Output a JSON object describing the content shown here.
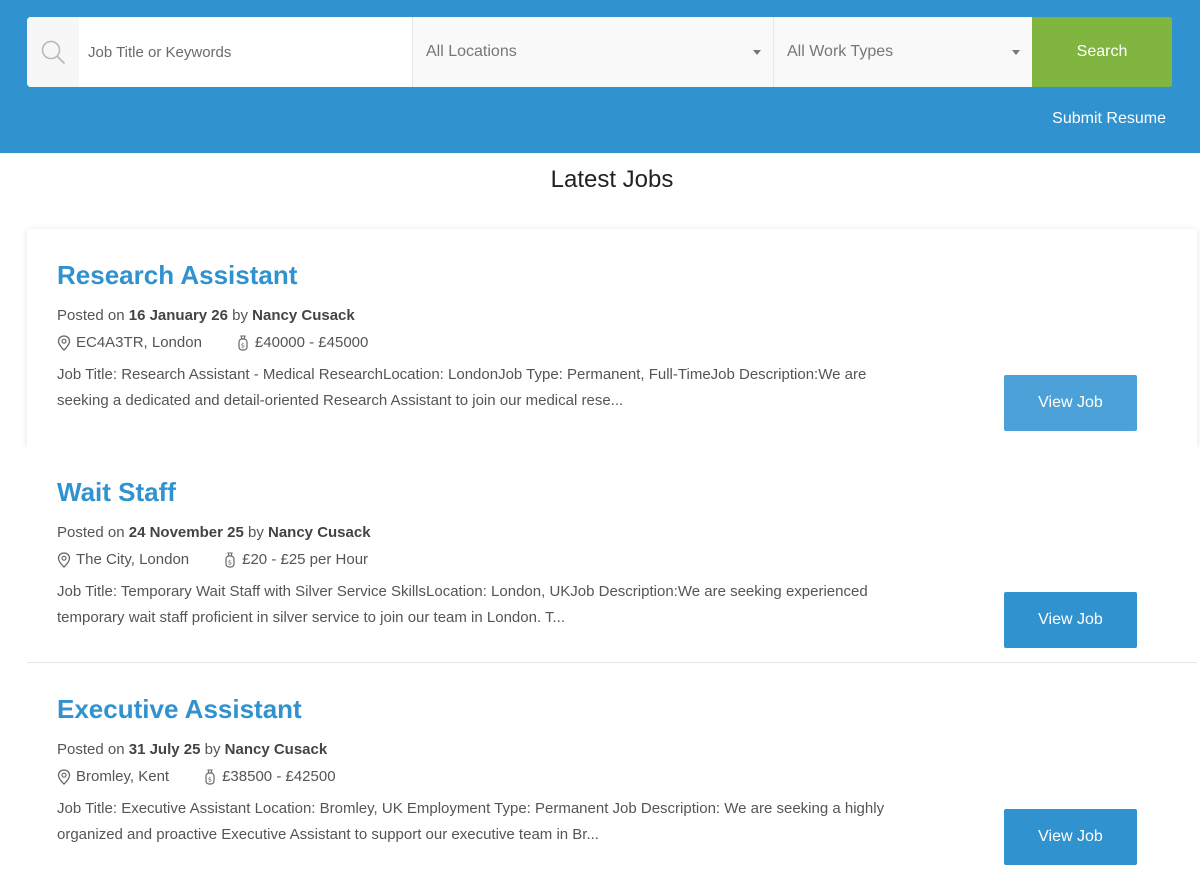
{
  "search": {
    "keywords_placeholder": "Job Title or Keywords",
    "keywords_value": "",
    "location_selected": "All Locations",
    "work_type_selected": "All Work Types",
    "search_label": "Search"
  },
  "header": {
    "submit_resume": "Submit Resume"
  },
  "section": {
    "title": "Latest Jobs"
  },
  "jobs": [
    {
      "title": "Research Assistant",
      "posted_prefix": "Posted on",
      "date": "16 January 26",
      "by_word": "by",
      "author": "Nancy Cusack",
      "location": "EC4A3TR, London",
      "salary": "£40000 - £45000",
      "description": "Job Title: Research Assistant - Medical ResearchLocation: LondonJob Type: Permanent, Full-TimeJob Description:We are seeking a dedicated and detail-oriented Research Assistant to join our medical rese...",
      "button": "View Job"
    },
    {
      "title": "Wait Staff",
      "posted_prefix": "Posted on",
      "date": "24 November 25",
      "by_word": "by",
      "author": "Nancy Cusack",
      "location": "The City, London",
      "salary": "£20 - £25 per Hour",
      "description": "Job Title: Temporary Wait Staff with Silver Service SkillsLocation: London, UKJob Description:We are seeking experienced temporary wait staff proficient in silver service to join our team in London. T...",
      "button": "View Job"
    },
    {
      "title": "Executive Assistant",
      "posted_prefix": "Posted on",
      "date": "31 July 25",
      "by_word": "by",
      "author": "Nancy Cusack",
      "location": "Bromley, Kent",
      "salary": "£38500 - £42500",
      "description": "Job Title: Executive Assistant Location: Bromley, UK Employment Type: Permanent Job Description: We are seeking a highly organized and proactive Executive Assistant to support our executive team in Br...",
      "button": "View Job"
    }
  ],
  "colors": {
    "header_bg": "#3092cf",
    "search_button": "#80b540",
    "job_title": "#3092cf",
    "view_button": "#3092cf"
  },
  "icons": {
    "search": "search-icon",
    "location": "map-pin-icon",
    "salary": "money-bag-icon",
    "dropdown": "chevron-down-icon"
  }
}
